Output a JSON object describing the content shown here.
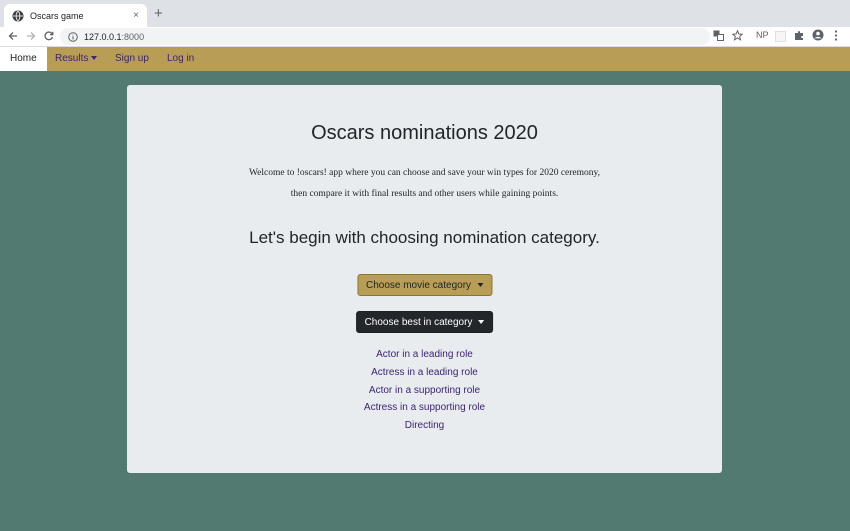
{
  "browser": {
    "tab_title": "Oscars game",
    "tab_close": "×",
    "new_tab": "+",
    "url_host": "127.0.0.1",
    "url_port": ":8000",
    "toolbar_np": "NP"
  },
  "navbar": {
    "home": "Home",
    "results": "Results",
    "signup": "Sign up",
    "login": "Log in"
  },
  "card": {
    "title": "Oscars nominations 2020",
    "intro_line1": "Welcome to !oscars! app where you can choose and save your win types for 2020 ceremony,",
    "intro_line2": "then compare it with final results and other users while gaining points.",
    "subtitle": "Let's begin with choosing nomination category.",
    "movie_button": "Choose movie category",
    "best_button": "Choose best in category",
    "categories": [
      "Actor in a leading role",
      "Actress in a leading role",
      "Actor in a supporting role",
      "Actress in a supporting role",
      "Directing"
    ]
  },
  "colors": {
    "page_bg": "#537a70",
    "navbar_bg": "#b89d55",
    "link": "#3b2474",
    "card_bg": "#e9ecef",
    "dark_button": "#23272b"
  }
}
